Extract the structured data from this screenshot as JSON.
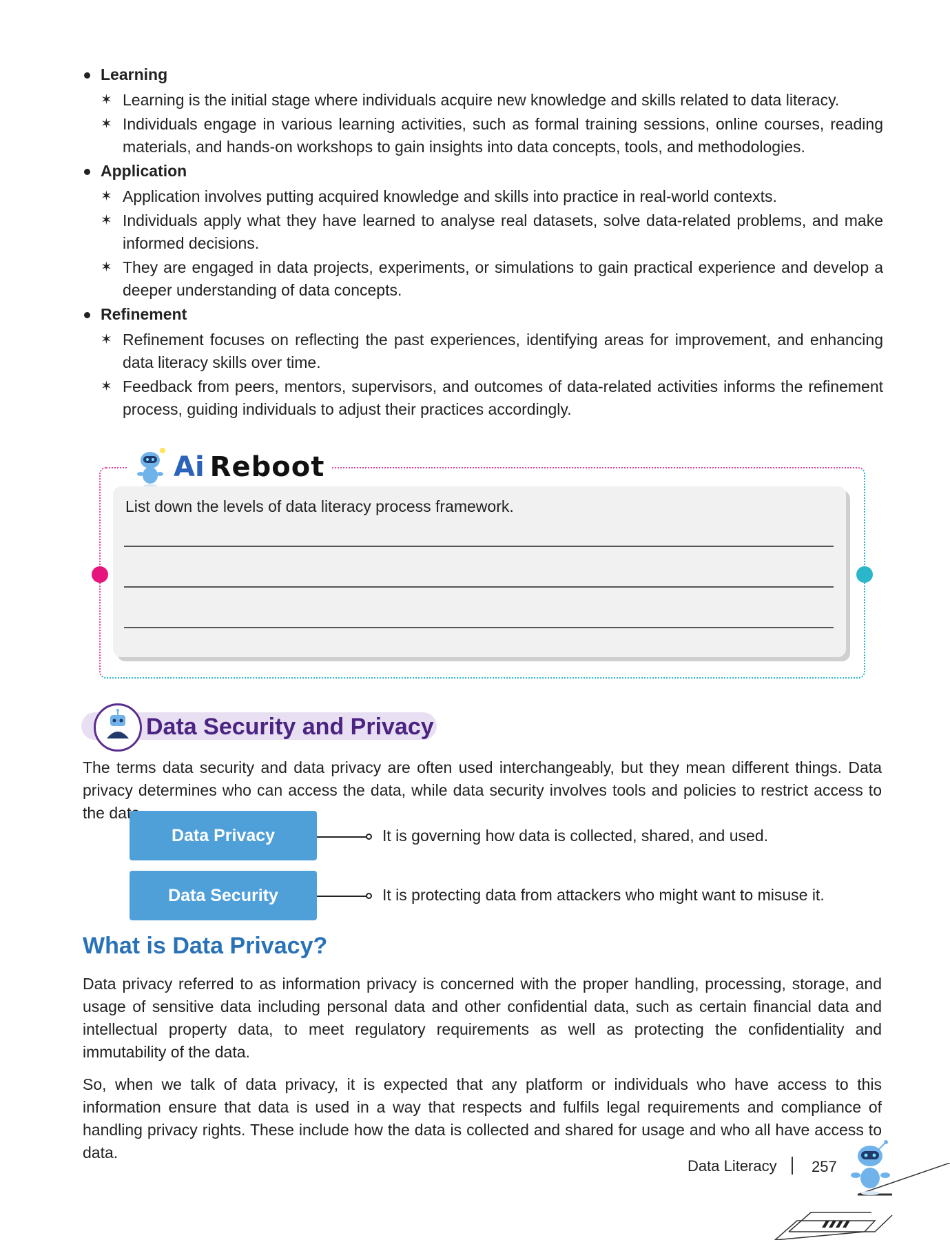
{
  "bullets": [
    {
      "heading": "Learning",
      "items": [
        "Learning is the initial stage where individuals acquire new knowledge and skills related to data literacy.",
        "Individuals engage in various learning activities, such as formal training sessions, online courses, reading materials, and hands-on workshops to gain insights into data concepts, tools, and methodologies."
      ]
    },
    {
      "heading": "Application",
      "items": [
        "Application involves putting acquired knowledge and skills into practice in real-world contexts.",
        "Individuals apply what they have learned to analyse real datasets, solve data-related problems, and make informed decisions.",
        "They are engaged in data projects, experiments, or simulations to gain practical experience and develop a deeper understanding of data concepts."
      ]
    },
    {
      "heading": "Refinement",
      "items": [
        "Refinement focuses on reflecting the past experiences, identifying areas for improvement, and enhancing data literacy skills over time.",
        "Feedback from peers, mentors, supervisors, and outcomes of data-related activities informs the refinement process, guiding individuals to adjust their practices accordingly."
      ]
    }
  ],
  "reboot": {
    "ai_mark": "Ai",
    "title": "Reboot",
    "question": "List down the levels of data literacy process framework."
  },
  "section": {
    "title": "Data Security and Privacy",
    "intro": "The terms data security and data privacy are often used interchangeably, but they mean different things. Data privacy determines who can access the data, while data security involves tools and policies to restrict access to the data."
  },
  "diagram": [
    {
      "label": "Data Privacy",
      "description": "It is governing how data is collected, shared, and used."
    },
    {
      "label": "Data Security",
      "description": "It is protecting data from attackers who might want to misuse it."
    }
  ],
  "privacy": {
    "heading": "What is Data Privacy?",
    "para1": "Data privacy referred to as information privacy is concerned with the proper handling, processing, storage, and usage of sensitive data including personal data and other confidential data, such as certain financial data and intellectual property data, to meet regulatory requirements as well as protecting the confidentiality and immutability of the data.",
    "para2": "So, when we talk of data privacy, it is expected that any platform or individuals who have access to this information ensure that data is used in a way that respects and fulfils legal requirements and compliance of handling privacy rights. These include how the data is collected and shared for usage and who all have access to data."
  },
  "footer": {
    "book": "Data Literacy",
    "page": "257"
  },
  "colors": {
    "pill": "#4f9fd8",
    "section_title": "#4b2482",
    "heading_blue": "#2a72b8",
    "reboot_pink": "#e6157e",
    "reboot_teal": "#2bb7c9"
  }
}
